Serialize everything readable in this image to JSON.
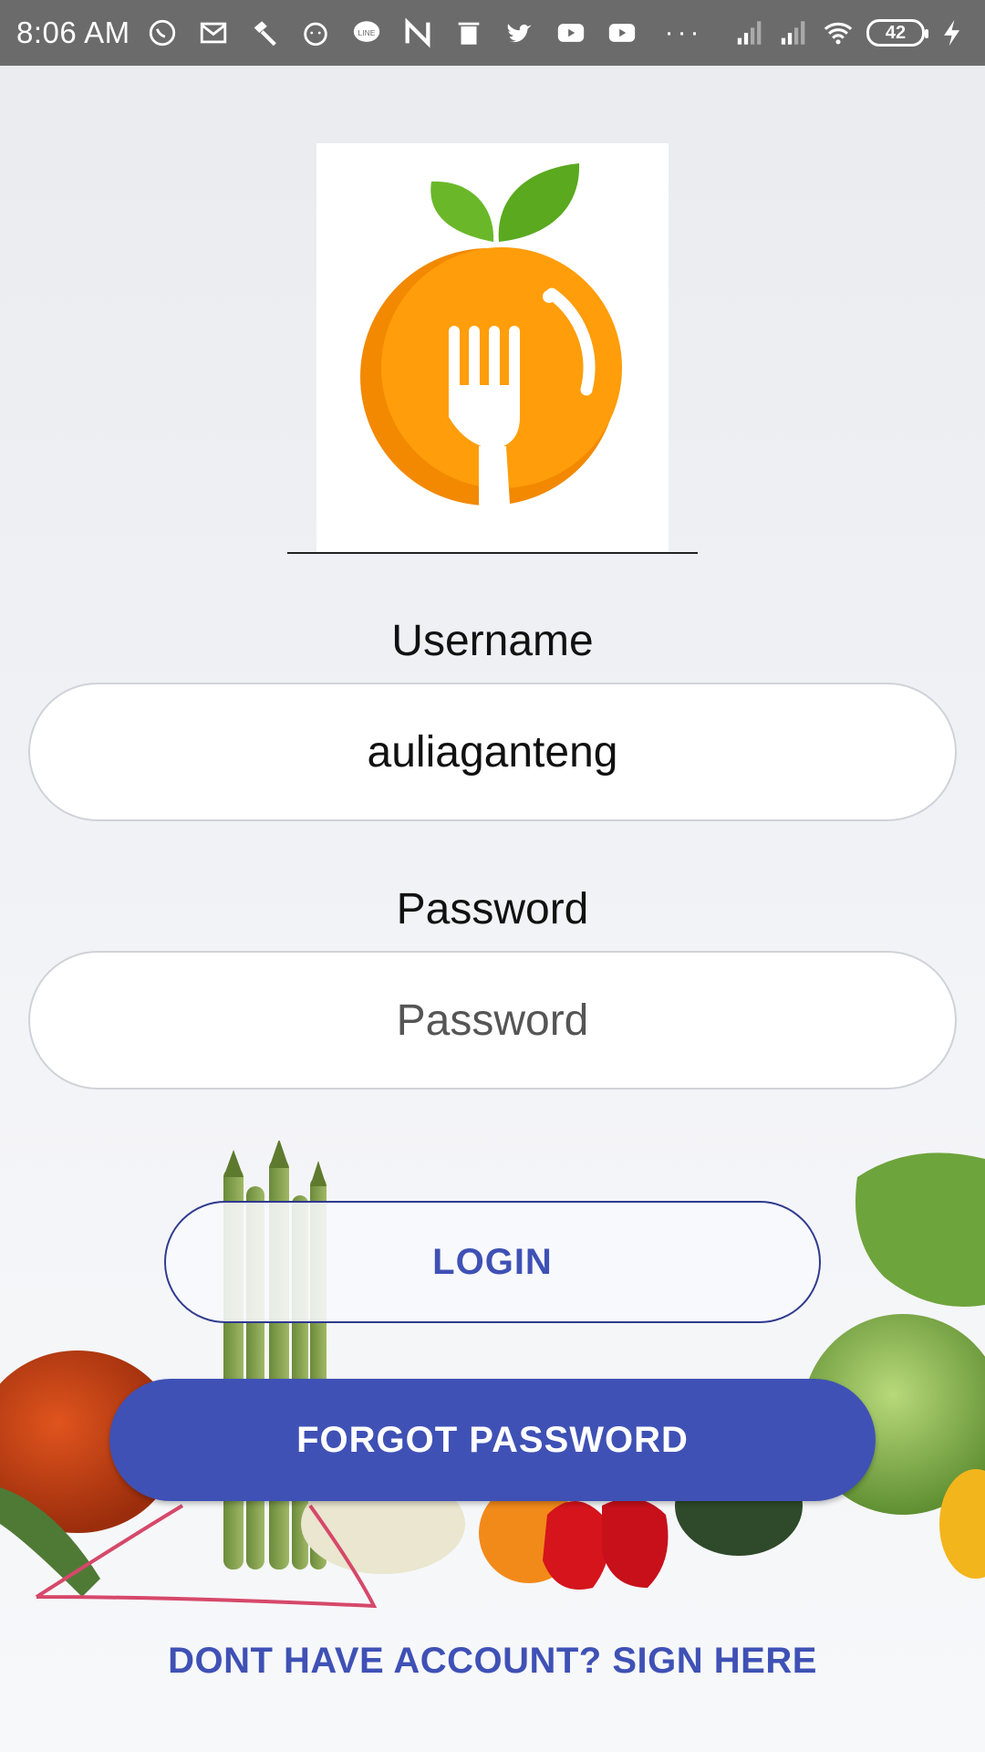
{
  "status_bar": {
    "time": "8:06 AM",
    "battery": "42",
    "icons": [
      "whatsapp-icon",
      "gmail-icon",
      "hammer-icon",
      "clock-face-icon",
      "line-icon",
      "n-icon",
      "trash-icon",
      "twitter-icon",
      "youtube-icon",
      "youtube-icon",
      "signal-icon",
      "signal-icon",
      "wifi-icon",
      "battery-icon",
      "charging-icon"
    ],
    "more": "···"
  },
  "login_form": {
    "username_label": "Username",
    "username_value": "auliaganteng",
    "password_label": "Password",
    "password_placeholder": "Password"
  },
  "actions": {
    "login_label": "LOGIN",
    "forgot_label": "FORGOT PASSWORD",
    "signup_label": "DONT HAVE ACCOUNT? SIGN HERE"
  },
  "colors": {
    "primary": "#3f51b5",
    "logo_orange": "#ff9800",
    "logo_green": "#6ab82a",
    "status_bar": "#6b6b6b"
  }
}
